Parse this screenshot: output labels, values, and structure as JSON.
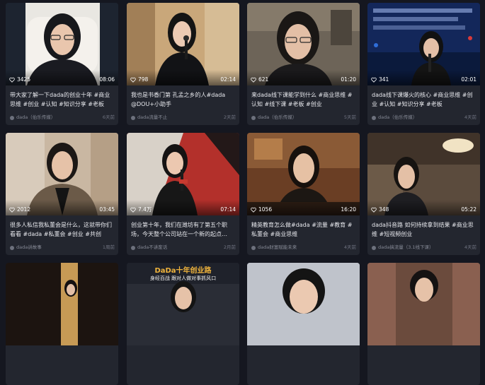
{
  "videos": [
    {
      "likes": "3425",
      "duration": "08:06",
      "caption": "带大家了解一下dada的创业十年 #商业思维 #创业 #认知 #知识分享 #老板",
      "author": "dada（伯乐传媒）",
      "date": "6天前"
    },
    {
      "likes": "798",
      "duration": "02:14",
      "caption": "我也是书香门第 孔孟之乡的人#dada @DOU+小助手",
      "author": "dada流量不止",
      "date": "2天前"
    },
    {
      "likes": "621",
      "duration": "01:20",
      "caption": "来dada线下课能学到什么 #商业思维 #认知 #线下课 #老板 #创业",
      "author": "dada（伯乐传媒）",
      "date": "5天前"
    },
    {
      "likes": "341",
      "duration": "02:01",
      "caption": "dada线下课爆火的核心 #商业思维 #创业 #认知 #知识分享 #老板",
      "author": "dada（伯乐传媒）",
      "date": "4天前"
    },
    {
      "likes": "2012",
      "duration": "03:45",
      "caption": "很多人私信我私董会是什么，这就带你们看看 #dada #私董会 #创业 #共创",
      "author": "dada讲故事",
      "date": "1周前"
    },
    {
      "likes": "7.4万",
      "duration": "07:14",
      "caption": "创业第十年，我们在潍坊有了第五个职场，今天整个公司站在一个新的起点…",
      "author": "dada不讲废话",
      "date": "2月前"
    },
    {
      "likes": "1056",
      "duration": "16:20",
      "caption": "精英教育怎么做#dada #流量 #教育 #私董会 #商业思维",
      "author": "dada财富赋能未来",
      "date": "4天前"
    },
    {
      "likes": "348",
      "duration": "05:22",
      "caption": "dada抖音路 如何持续拿到结果 #商业思维 #短视频创业",
      "author": "dada搞流量（3.1线下课）",
      "date": "4天前"
    },
    {
      "badge": "",
      "banner_title": "",
      "banner_sub": ""
    },
    {
      "banner_title": "DaDa十年创业路",
      "banner_sub": "身经百战  跟对人做对事抓风口"
    },
    {},
    {}
  ]
}
